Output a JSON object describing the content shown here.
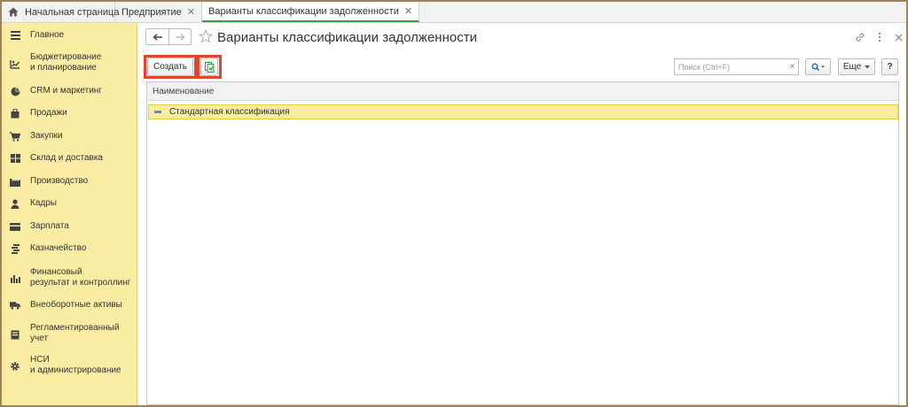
{
  "tabs": [
    {
      "label": "Начальная страница"
    },
    {
      "label": "Предприятие"
    },
    {
      "label": "Варианты классификации задолженности"
    }
  ],
  "sidebar": {
    "items": [
      {
        "label": "Главное",
        "icon": "menu-icon"
      },
      {
        "label": "Бюджетирование\nи планирование",
        "icon": "budget-icon"
      },
      {
        "label": "CRM и маркетинг",
        "icon": "pie-chart-icon"
      },
      {
        "label": "Продажи",
        "icon": "shopping-bag-icon"
      },
      {
        "label": "Закупки",
        "icon": "cart-icon"
      },
      {
        "label": "Склад и доставка",
        "icon": "warehouse-icon"
      },
      {
        "label": "Производство",
        "icon": "factory-icon"
      },
      {
        "label": "Кадры",
        "icon": "person-icon"
      },
      {
        "label": "Зарплата",
        "icon": "wallet-icon"
      },
      {
        "label": "Казначейство",
        "icon": "coins-icon"
      },
      {
        "label": "Финансовый\nрезультат и контроллинг",
        "icon": "bar-chart-icon"
      },
      {
        "label": "Внеоборотные активы",
        "icon": "truck-icon"
      },
      {
        "label": "Регламентированный\nучет",
        "icon": "report-icon"
      },
      {
        "label": "НСИ\nи администрирование",
        "icon": "gear-icon"
      }
    ]
  },
  "page": {
    "title": "Варианты классификации задолженности"
  },
  "toolbar": {
    "create_label": "Создать",
    "search_placeholder": "Поиск (Ctrl+F)",
    "clear_label": "×",
    "more_label": "Еще",
    "help_label": "?"
  },
  "table": {
    "columns": [
      "Наименование"
    ],
    "rows": [
      {
        "name": "Стандартная классификация"
      }
    ]
  },
  "colors": {
    "sidebar_bg": "#fbeca4",
    "selected_row": "#fbeca0",
    "highlight": "#e0452d",
    "active_tab_underline": "#3a9b3a"
  }
}
